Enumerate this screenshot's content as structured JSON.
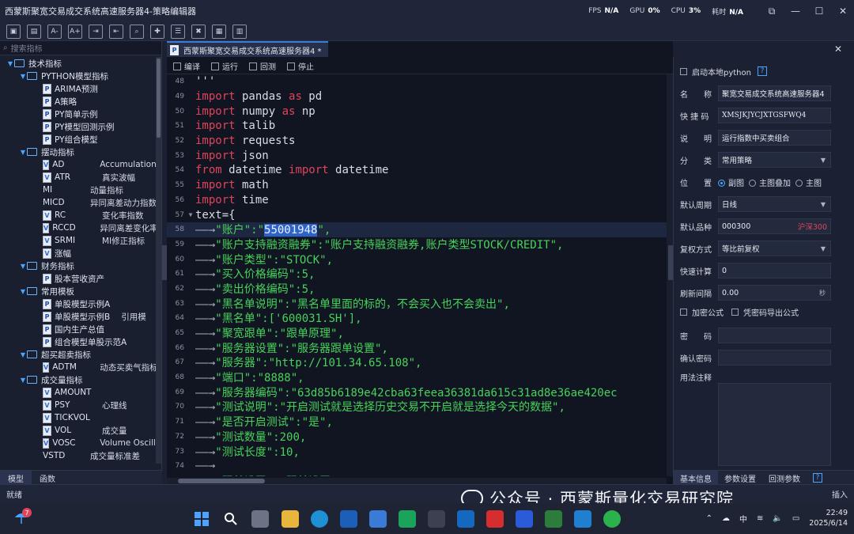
{
  "window": {
    "title": "西蒙斯聚宽交易成交系统高速服务器4-策略编辑器",
    "stats": [
      {
        "label": "FPS",
        "value": "N/A"
      },
      {
        "label": "GPU",
        "value": "0%"
      },
      {
        "label": "CPU",
        "value": "3%"
      },
      {
        "label": "耗时",
        "value": "N/A"
      }
    ]
  },
  "toolbar": {
    "icons": [
      "save-icon",
      "save-all-icon",
      "font-decrease-icon",
      "font-increase-icon",
      "export-icon",
      "import-icon",
      "search-file-icon",
      "add-file-icon",
      "list-icon",
      "delete-icon",
      "report-icon",
      "compile-icon"
    ]
  },
  "left": {
    "search_placeholder": "搜索指标",
    "tabs": [
      "模型",
      "函数"
    ],
    "tree": [
      {
        "level": 0,
        "type": "folder",
        "label": "技术指标"
      },
      {
        "level": 1,
        "type": "folder",
        "label": "PYTHON模型指标"
      },
      {
        "level": 2,
        "type": "P",
        "label": "ARIMA预测"
      },
      {
        "level": 2,
        "type": "P",
        "label": "A策略"
      },
      {
        "level": 2,
        "type": "P",
        "label": "PY简单示例"
      },
      {
        "level": 2,
        "type": "P",
        "label": "PY模型回测示例"
      },
      {
        "level": 2,
        "type": "P",
        "label": "PY组合模型"
      },
      {
        "level": 1,
        "type": "folder",
        "label": "摆动指标"
      },
      {
        "level": 2,
        "type": "V",
        "label": "AD",
        "desc": "Accumulation or"
      },
      {
        "level": 2,
        "type": "V",
        "label": "ATR",
        "desc": "真实波幅"
      },
      {
        "level": 2,
        "type": "none",
        "label": "MI",
        "desc": "动量指标"
      },
      {
        "level": 2,
        "type": "none",
        "label": "MICD",
        "desc": "异同离差动力指数"
      },
      {
        "level": 2,
        "type": "V",
        "label": "RC",
        "desc": "变化率指数"
      },
      {
        "level": 2,
        "type": "V",
        "label": "RCCD",
        "desc": "异同离差变化率"
      },
      {
        "level": 2,
        "type": "V",
        "label": "SRMI",
        "desc": "MI修正指标"
      },
      {
        "level": 2,
        "type": "V",
        "label": "涨幅"
      },
      {
        "level": 1,
        "type": "folder",
        "label": "财务指标"
      },
      {
        "level": 2,
        "type": "P",
        "label": "股本营收资产"
      },
      {
        "level": 1,
        "type": "folder",
        "label": "常用模板"
      },
      {
        "level": 2,
        "type": "P",
        "label": "单股模型示例A"
      },
      {
        "level": 2,
        "type": "P",
        "label": "单股模型示例B",
        "desc": "引用模"
      },
      {
        "level": 2,
        "type": "P",
        "label": "国内生产总值"
      },
      {
        "level": 2,
        "type": "P",
        "label": "组合模型单股示范A"
      },
      {
        "level": 1,
        "type": "folder",
        "label": "超买超卖指标"
      },
      {
        "level": 2,
        "type": "V",
        "label": "ADTM",
        "desc": "动态买卖气指标"
      },
      {
        "level": 1,
        "type": "folder",
        "label": "成交量指标"
      },
      {
        "level": 2,
        "type": "V",
        "label": "AMOUNT"
      },
      {
        "level": 2,
        "type": "V",
        "label": "PSY",
        "desc": "心理线"
      },
      {
        "level": 2,
        "type": "V",
        "label": "TICKVOL"
      },
      {
        "level": 2,
        "type": "V",
        "label": "VOL",
        "desc": "成交量"
      },
      {
        "level": 2,
        "type": "V",
        "label": "VOSC",
        "desc": "Volume Oscilla"
      },
      {
        "level": 2,
        "type": "none",
        "label": "VSTD",
        "desc": "成交量标准差"
      }
    ]
  },
  "editor": {
    "tab_title": "西蒙斯聚宽交易成交系统高速服务器4 *",
    "tools": [
      "编译",
      "运行",
      "回测",
      "停止"
    ],
    "lines": [
      {
        "n": "48",
        "parts": [
          [
            "id",
            "'''"
          ]
        ]
      },
      {
        "n": "49",
        "parts": [
          [
            "kw",
            "import"
          ],
          [
            "id",
            " pandas "
          ],
          [
            "kw",
            "as"
          ],
          [
            "id",
            " pd"
          ]
        ]
      },
      {
        "n": "50",
        "parts": [
          [
            "kw",
            "import"
          ],
          [
            "id",
            " numpy "
          ],
          [
            "kw",
            "as"
          ],
          [
            "id",
            " np"
          ]
        ]
      },
      {
        "n": "51",
        "parts": [
          [
            "kw",
            "import"
          ],
          [
            "id",
            " talib"
          ]
        ]
      },
      {
        "n": "52",
        "parts": [
          [
            "kw",
            "import"
          ],
          [
            "id",
            " requests"
          ]
        ]
      },
      {
        "n": "53",
        "parts": [
          [
            "kw",
            "import"
          ],
          [
            "id",
            " json"
          ]
        ]
      },
      {
        "n": "54",
        "parts": [
          [
            "kw",
            "from"
          ],
          [
            "id",
            " datetime "
          ],
          [
            "kw",
            "import"
          ],
          [
            "id",
            " datetime"
          ]
        ]
      },
      {
        "n": "55",
        "parts": [
          [
            "kw",
            "import"
          ],
          [
            "id",
            " math"
          ]
        ]
      },
      {
        "n": "56",
        "parts": [
          [
            "kw",
            "import"
          ],
          [
            "id",
            " time"
          ]
        ]
      },
      {
        "n": "57",
        "fold": true,
        "parts": [
          [
            "id",
            "text={"
          ]
        ]
      },
      {
        "n": "58",
        "hl": true,
        "parts": [
          [
            "arrow",
            "——→"
          ],
          [
            "str",
            "\"账户\":\""
          ],
          [
            "sel",
            "55001948"
          ],
          [
            "str",
            "\","
          ]
        ]
      },
      {
        "n": "59",
        "parts": [
          [
            "arrow",
            "——→"
          ],
          [
            "str",
            "\"账户支持融资融券\":\"账户支持融资融券,账户类型STOCK/CREDIT\","
          ]
        ]
      },
      {
        "n": "60",
        "parts": [
          [
            "arrow",
            "——→"
          ],
          [
            "str",
            "\"账户类型\":\"STOCK\","
          ]
        ]
      },
      {
        "n": "61",
        "parts": [
          [
            "arrow",
            "——→"
          ],
          [
            "str",
            "\"买入价格编码\":5,"
          ]
        ]
      },
      {
        "n": "62",
        "parts": [
          [
            "arrow",
            "——→"
          ],
          [
            "str",
            "\"卖出价格编码\":5,"
          ]
        ]
      },
      {
        "n": "63",
        "parts": [
          [
            "arrow",
            "——→"
          ],
          [
            "str",
            "\"黑名单说明\":\"黑名单里面的标的，不会买入也不会卖出\","
          ]
        ]
      },
      {
        "n": "64",
        "parts": [
          [
            "arrow",
            "——→"
          ],
          [
            "str",
            "\"黑名单\":['600031.SH'],"
          ]
        ]
      },
      {
        "n": "65",
        "parts": [
          [
            "arrow",
            "——→"
          ],
          [
            "str",
            "\"聚宽跟单\":\"跟单原理\","
          ]
        ]
      },
      {
        "n": "66",
        "parts": [
          [
            "arrow",
            "——→"
          ],
          [
            "str",
            "\"服务器设置\":\"服务器跟单设置\","
          ]
        ]
      },
      {
        "n": "67",
        "parts": [
          [
            "arrow",
            "——→"
          ],
          [
            "str",
            "\"服务器\":\"http://101.34.65.108\","
          ]
        ]
      },
      {
        "n": "68",
        "parts": [
          [
            "arrow",
            "——→"
          ],
          [
            "str",
            "\"端口\":\"8888\","
          ]
        ]
      },
      {
        "n": "69",
        "parts": [
          [
            "arrow",
            "——→"
          ],
          [
            "str",
            "\"服务器编码\":\"63d85b6189e42cba63feea36381da615c31ad8e36ae420ec"
          ]
        ]
      },
      {
        "n": "70",
        "parts": [
          [
            "arrow",
            "——→"
          ],
          [
            "str",
            "\"测试说明\":\"开启测试就是选择历史交易不开启就是选择今天的数据\","
          ]
        ]
      },
      {
        "n": "71",
        "parts": [
          [
            "arrow",
            "——→"
          ],
          [
            "str",
            "\"是否开启测试\":\"是\","
          ]
        ]
      },
      {
        "n": "72",
        "parts": [
          [
            "arrow",
            "——→"
          ],
          [
            "str",
            "\"测试数量\":200,"
          ]
        ]
      },
      {
        "n": "73",
        "parts": [
          [
            "arrow",
            "——→"
          ],
          [
            "str",
            "\"测试长度\":10,"
          ]
        ]
      },
      {
        "n": "74",
        "parts": [
          [
            "arrow",
            "——→"
          ]
        ]
      },
      {
        "n": "75",
        "parts": [
          [
            "arrow",
            "——→"
          ],
          [
            "str",
            "\"跟单设置\":\"跟单设置***********\","
          ]
        ]
      }
    ]
  },
  "right": {
    "local_python_label": "启动本地python",
    "fields": {
      "name_label": "名　　称",
      "name_value": "聚宽交易成交系统高速服务器4",
      "shortcut_label": "快 捷 码",
      "shortcut_value": "XMSJKJYCJXTGSFWQ4",
      "desc_label": "说　　明",
      "desc_value": "运行指数中买卖组合",
      "category_label": "分　　类",
      "category_value": "常用策略",
      "position_label": "位　　置",
      "position_options": [
        "副图",
        "主图叠加",
        "主图"
      ],
      "period_label": "默认周期",
      "period_value": "日线",
      "symbol_label": "默认品种",
      "symbol_value": "000300",
      "symbol_name": "沪深300",
      "adjust_label": "复权方式",
      "adjust_value": "等比前复权",
      "quick_label": "快速计算",
      "quick_value": "0",
      "refresh_label": "刷新间隔",
      "refresh_value": "0.00",
      "refresh_unit": "秒",
      "encrypt_label": "加密公式",
      "export_label": "凭密码导出公式",
      "pwd_label": "密　　码",
      "pwd_confirm_label": "确认密码",
      "notes_label": "用法注释"
    },
    "tabs": [
      "基本信息",
      "参数设置",
      "回测参数"
    ]
  },
  "status": {
    "left": "就绪",
    "right": "插入"
  },
  "watermark": "公众号 · 西蒙斯量化交易研究院",
  "taskbar": {
    "weather_badge": "7",
    "tray_text": "中",
    "time": "22:49",
    "date": "2025/6/14"
  }
}
